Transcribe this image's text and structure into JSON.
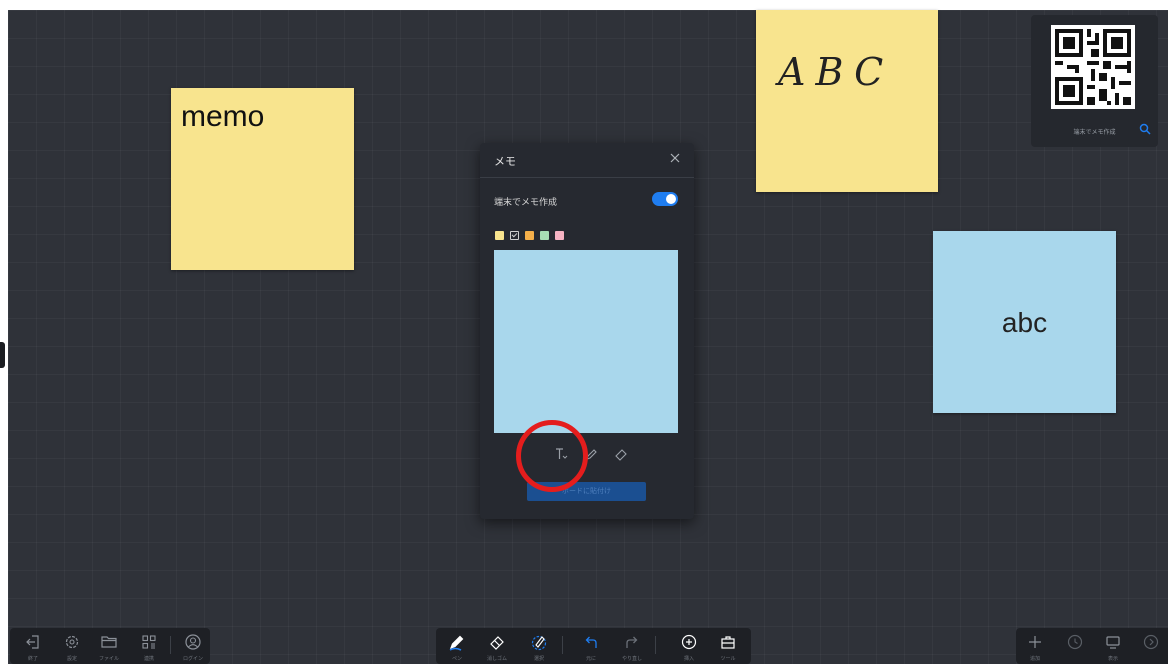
{
  "notes": {
    "memo": "memo",
    "handwritten": "ABC",
    "blue": "abc"
  },
  "qr_panel": {
    "icon": "qr-code-icon",
    "label": "端末でメモ作成"
  },
  "dialog": {
    "title": "メモ",
    "toggle_label": "端末でメモ作成",
    "toggle_on": true,
    "colors": [
      "#f8e48e",
      "#a9d7ec",
      "#f5b04a",
      "#a8ddb4",
      "#f6b3c3"
    ],
    "selected_color_index": 1,
    "tools": [
      "text-tool-icon",
      "pen-tool-icon",
      "eraser-tool-icon"
    ],
    "paste_button": "ボードに貼付け"
  },
  "toolbar_left": [
    {
      "icon": "exit-icon",
      "label": "終了"
    },
    {
      "icon": "gear-icon",
      "label": "設定"
    },
    {
      "icon": "folder-icon",
      "label": "ファイル"
    },
    {
      "icon": "apps-icon",
      "label": "連携"
    },
    {
      "icon": "user-icon",
      "label": "ログイン"
    }
  ],
  "toolbar_center": [
    {
      "icon": "pen-icon",
      "label": "ペン"
    },
    {
      "icon": "eraser-icon",
      "label": "消しゴム"
    },
    {
      "icon": "select-icon",
      "label": "選択"
    },
    {
      "icon": "undo-icon",
      "label": "元に"
    },
    {
      "icon": "redo-icon",
      "label": "やり直し"
    },
    {
      "icon": "insert-icon",
      "label": "挿入"
    },
    {
      "icon": "tools-icon",
      "label": "ツール"
    }
  ],
  "toolbar_right": [
    {
      "icon": "plus-icon",
      "label": "追加"
    },
    {
      "icon": "clock-icon",
      "label": ""
    },
    {
      "icon": "screen-icon",
      "label": "表示"
    },
    {
      "icon": "arrow-right-icon",
      "label": ""
    }
  ],
  "colors": {
    "board": "#2f3239",
    "accent": "#1f7df0",
    "highlight": "#e41d1d"
  }
}
